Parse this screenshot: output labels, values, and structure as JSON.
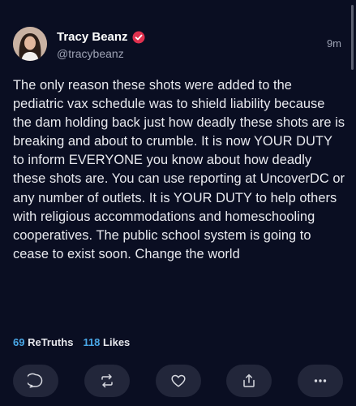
{
  "post": {
    "display_name": "Tracy Beanz",
    "handle": "@tracybeanz",
    "timestamp": "9m",
    "body": "The only reason these shots were added to the pediatric vax schedule was to shield liability because the dam holding back just how deadly these shots are is breaking and about to crumble. It is now YOUR DUTY to inform EVERYONE you know about how deadly these shots are. You can use reporting at UncoverDC or any number of outlets. It is YOUR DUTY to help others with religious accommodations and homeschooling cooperatives. The public school system is going to cease to exist soon. Change the world",
    "verified_badge_color": "#e0314f"
  },
  "stats": {
    "retruths_count": "69",
    "retruths_label": "ReTruths",
    "likes_count": "118",
    "likes_label": "Likes",
    "count_color": "#4aa8e8"
  },
  "actions": [
    {
      "icon": "comment-icon"
    },
    {
      "icon": "retruth-icon"
    },
    {
      "icon": "heart-icon"
    },
    {
      "icon": "share-icon"
    },
    {
      "icon": "more-icon"
    }
  ]
}
